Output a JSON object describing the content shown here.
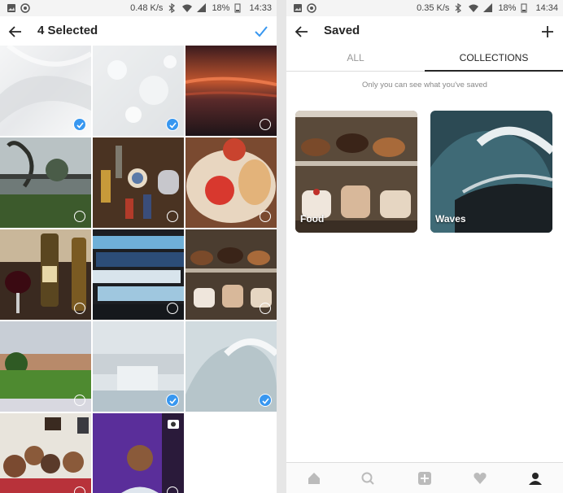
{
  "left_screen": {
    "status": {
      "speed": "0.48 K/s",
      "battery": "18%",
      "time": "14:33"
    },
    "header": {
      "title": "4 Selected"
    },
    "icons": {
      "back": "back-arrow-icon",
      "confirm": "checkmark-icon"
    },
    "accent_color": "#3897f0",
    "grid": [
      {
        "name": "photo-feather",
        "selected": true
      },
      {
        "name": "photo-water-splash",
        "selected": true
      },
      {
        "name": "photo-sunset-water",
        "selected": false
      },
      {
        "name": "photo-rainy-garden",
        "selected": false
      },
      {
        "name": "photo-curios-teapot",
        "selected": false
      },
      {
        "name": "photo-food-plate",
        "selected": false
      },
      {
        "name": "photo-whisky-wine",
        "selected": false
      },
      {
        "name": "photo-books-stack",
        "selected": false
      },
      {
        "name": "photo-cakes-display",
        "selected": false
      },
      {
        "name": "photo-parliament-lawn",
        "selected": false
      },
      {
        "name": "photo-fountain-building",
        "selected": true
      },
      {
        "name": "photo-wave",
        "selected": true
      },
      {
        "name": "photo-friends-selfie",
        "selected": false
      },
      {
        "name": "video-man-portrait",
        "selected": false
      }
    ]
  },
  "right_screen": {
    "status": {
      "speed": "0.35 K/s",
      "battery": "18%",
      "time": "14:34"
    },
    "header": {
      "title": "Saved"
    },
    "icons": {
      "back": "back-arrow-icon",
      "add": "plus-icon"
    },
    "tabs": [
      {
        "label": "ALL",
        "active": false
      },
      {
        "label": "COLLECTIONS",
        "active": true
      }
    ],
    "privacy_note": "Only you can see what you've saved",
    "collections": [
      {
        "label": "Food"
      },
      {
        "label": "Waves"
      }
    ],
    "bottom_nav": [
      "home-icon",
      "search-icon",
      "add-post-icon",
      "heart-icon",
      "profile-icon"
    ]
  }
}
